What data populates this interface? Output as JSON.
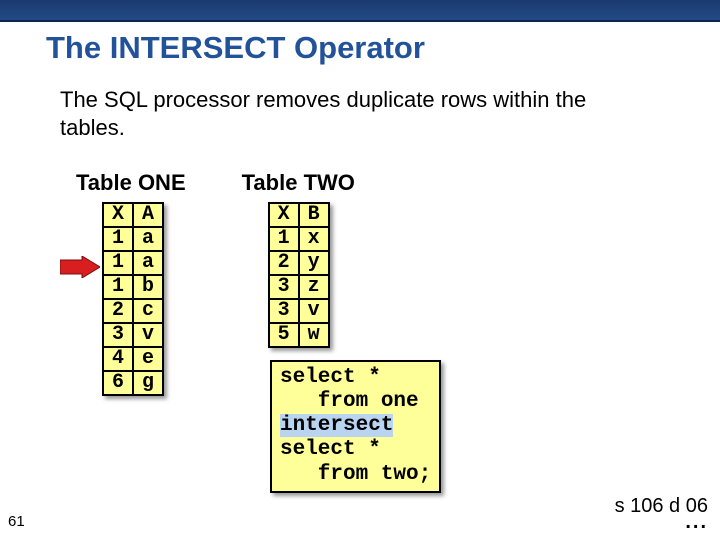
{
  "title": "The INTERSECT Operator",
  "description": "The SQL processor removes duplicate rows within the tables.",
  "table_one": {
    "caption": "Table ONE",
    "headers": [
      "X",
      "A"
    ],
    "rows": [
      [
        "1",
        "a"
      ],
      [
        "1",
        "a"
      ],
      [
        "1",
        "b"
      ],
      [
        "2",
        "c"
      ],
      [
        "3",
        "v"
      ],
      [
        "4",
        "e"
      ],
      [
        "6",
        "g"
      ]
    ]
  },
  "table_two": {
    "caption": "Table TWO",
    "headers": [
      "X",
      "B"
    ],
    "rows": [
      [
        "1",
        "x"
      ],
      [
        "2",
        "y"
      ],
      [
        "3",
        "z"
      ],
      [
        "3",
        "v"
      ],
      [
        "5",
        "w"
      ]
    ]
  },
  "code": {
    "lines": [
      "select *",
      "   from one",
      "intersect",
      "select *",
      "   from two;"
    ],
    "highlight_line_index": 2
  },
  "slide_number": "61",
  "footnote": "s 106 d 06",
  "dots": "..."
}
